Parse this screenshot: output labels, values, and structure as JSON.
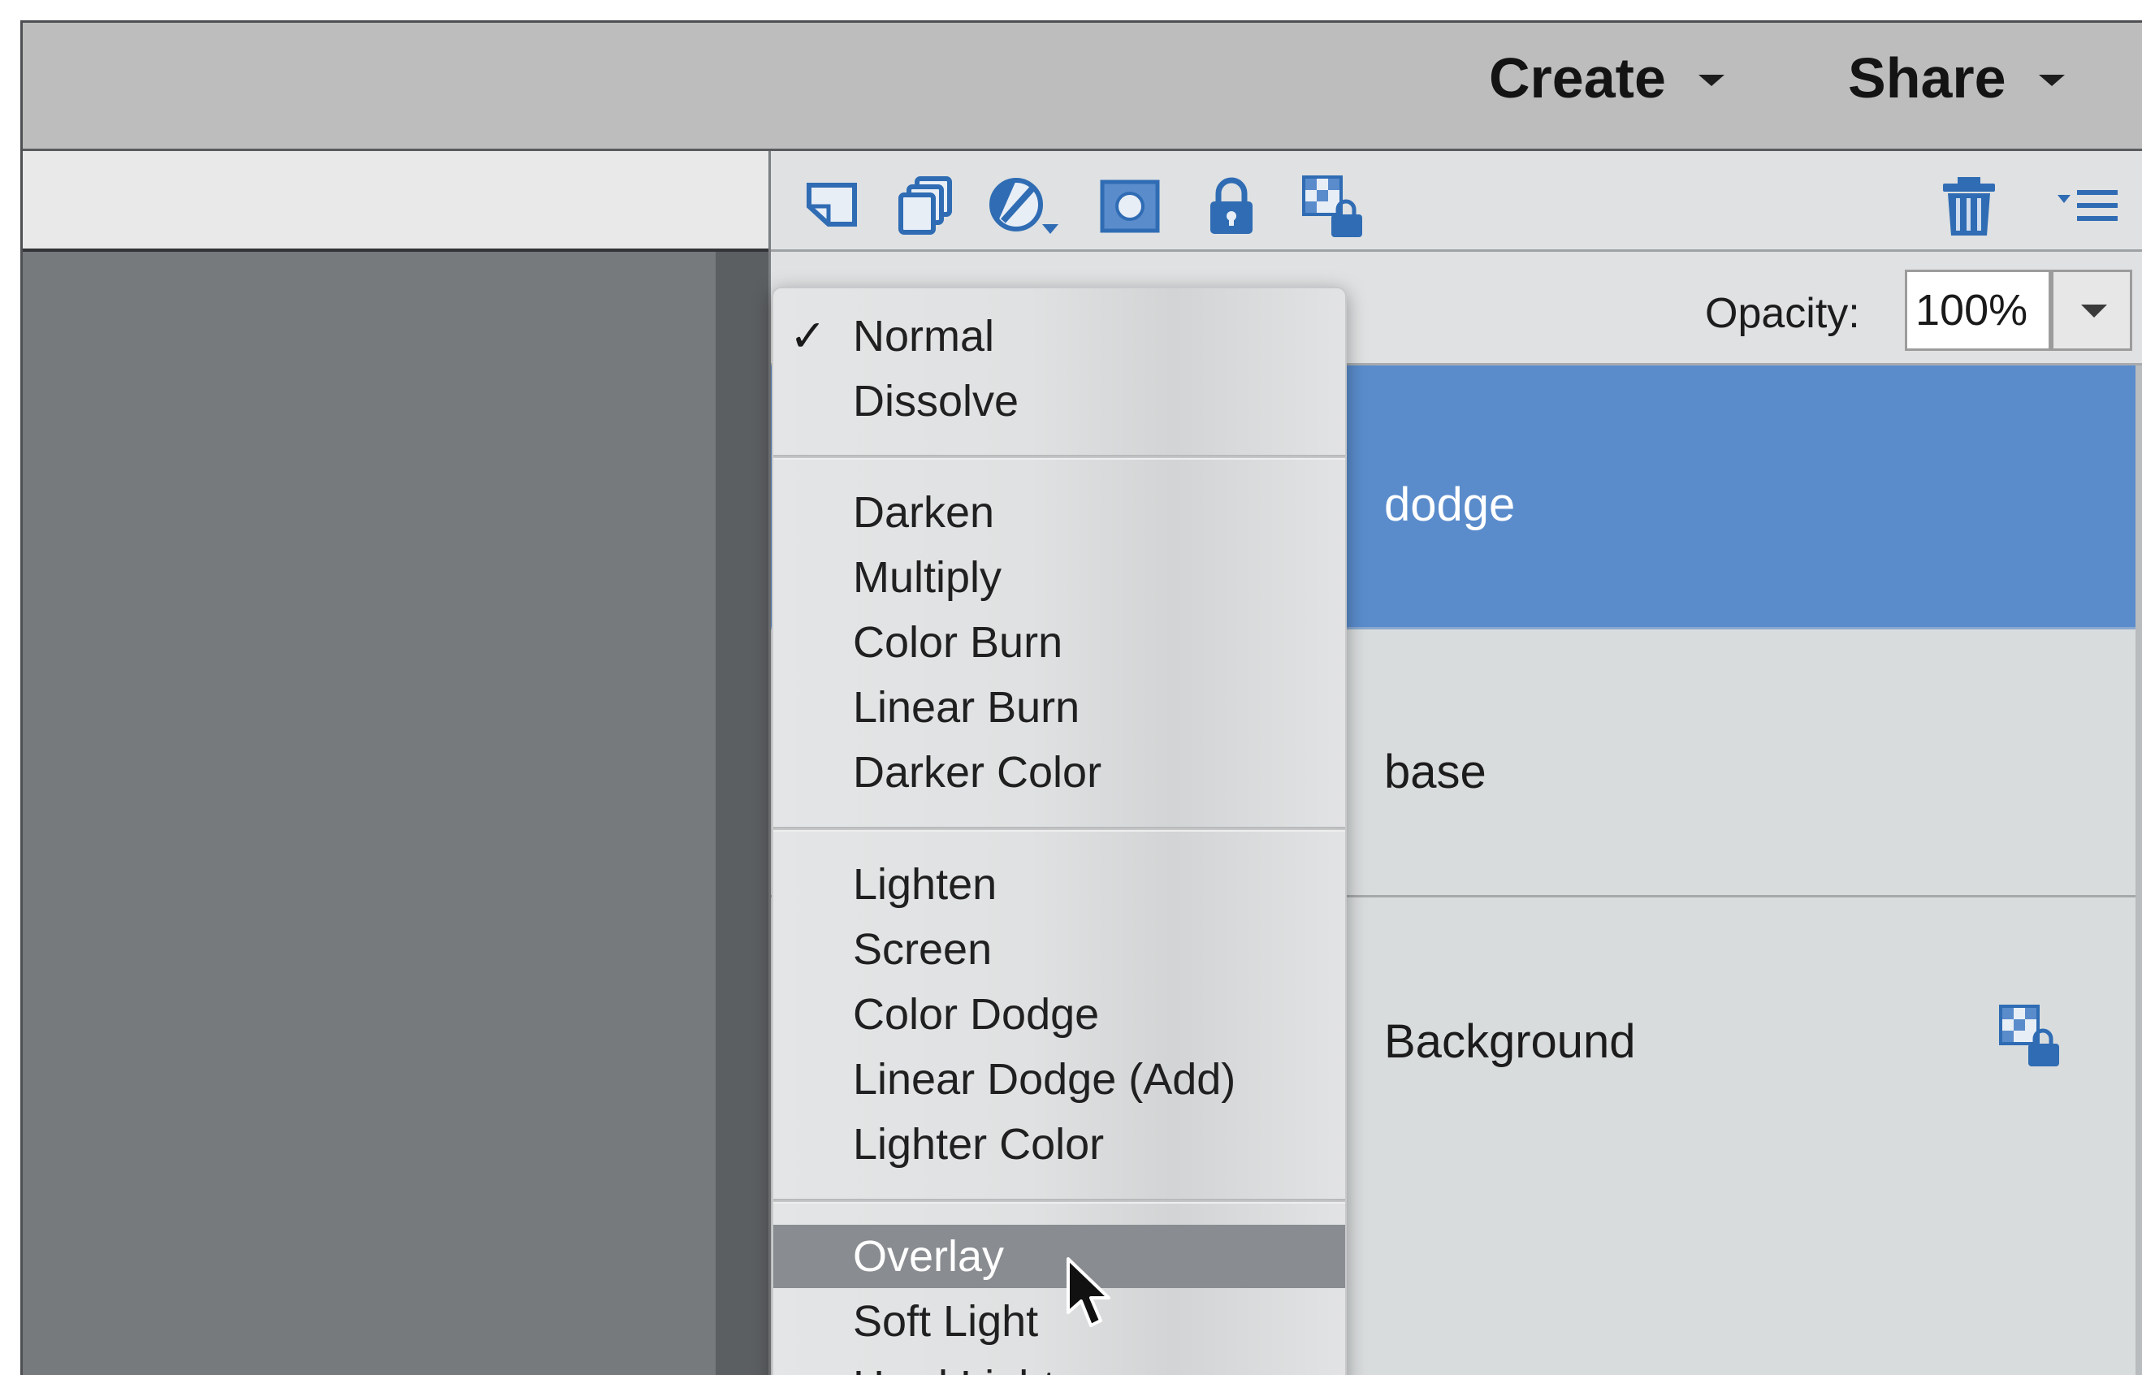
{
  "header": {
    "create_label": "Create",
    "share_label": "Share"
  },
  "layers_toolbar": {
    "icons": [
      "new-layer-icon",
      "new-group-icon",
      "adjustment-layer-icon",
      "layer-mask-icon",
      "lock-all-icon",
      "lock-transparent-icon",
      "trash-icon",
      "panel-menu-icon"
    ]
  },
  "opacity": {
    "label": "Opacity:",
    "value": "100%"
  },
  "blend_menu": {
    "checked": "Normal",
    "highlighted": "Overlay",
    "groups": [
      [
        "Normal",
        "Dissolve"
      ],
      [
        "Darken",
        "Multiply",
        "Color Burn",
        "Linear Burn",
        "Darker Color"
      ],
      [
        "Lighten",
        "Screen",
        "Color Dodge",
        "Linear Dodge (Add)",
        "Lighter Color"
      ],
      [
        "Overlay",
        "Soft Light",
        "Hard Light"
      ]
    ],
    "items": {
      "normal": "Normal",
      "dissolve": "Dissolve",
      "darken": "Darken",
      "multiply": "Multiply",
      "color_burn": "Color Burn",
      "linear_burn": "Linear Burn",
      "darker_color": "Darker Color",
      "lighten": "Lighten",
      "screen": "Screen",
      "color_dodge": "Color Dodge",
      "linear_dodge": "Linear Dodge (Add)",
      "lighter_color": "Lighter Color",
      "overlay": "Overlay",
      "soft_light": "Soft Light",
      "hard_light": "Hard Light"
    },
    "checkmark": "✓"
  },
  "layers": [
    {
      "name": "dodge",
      "selected": true
    },
    {
      "name": "base",
      "selected": false
    },
    {
      "name": "Background",
      "selected": false,
      "locked": true
    }
  ],
  "colors": {
    "selected_row": "#5a8ccc",
    "menu_highlight": "#898c90",
    "icon_blue": "#2f6cb4"
  }
}
